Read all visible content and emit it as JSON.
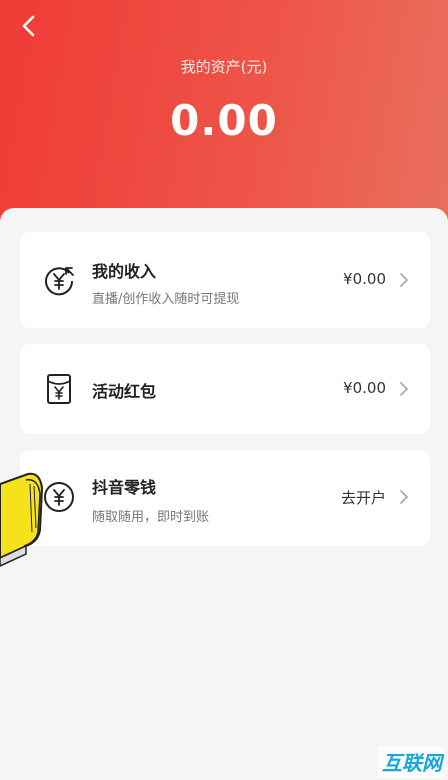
{
  "header": {
    "assets_label": "我的资产(元)",
    "assets_value": "0.00"
  },
  "cards": [
    {
      "title": "我的收入",
      "subtitle": "直播/创作收入随时可提现",
      "value": "¥0.00",
      "icon": "yuan-income-icon"
    },
    {
      "title": "活动红包",
      "subtitle": "",
      "value": "¥0.00",
      "icon": "red-envelope-icon"
    },
    {
      "title": "抖音零钱",
      "subtitle": "随取随用，即时到账",
      "value": "去开户",
      "icon": "yuan-coin-icon"
    }
  ],
  "watermark": "互联网",
  "colors": {
    "header_start": "#ef3b36",
    "header_end": "#e8705d",
    "card_bg": "#ffffff",
    "page_bg": "#f5f5f5"
  }
}
